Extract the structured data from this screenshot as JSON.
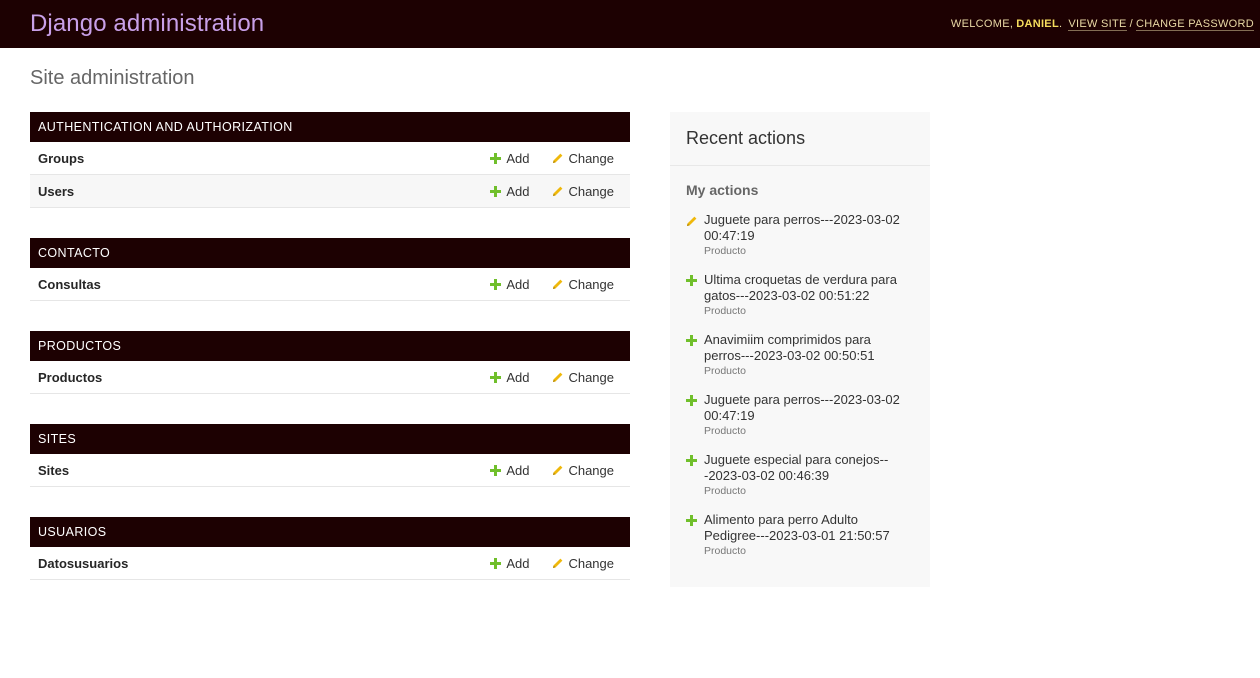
{
  "header": {
    "branding": "Django administration",
    "welcome": "WELCOME,",
    "username": "DANIEL",
    "username_suffix": ".",
    "view_site": "VIEW SITE",
    "separator": "/",
    "change_password": "CHANGE PASSWORD"
  },
  "page_title": "Site administration",
  "modules": [
    {
      "caption": "AUTHENTICATION AND AUTHORIZATION",
      "models": [
        {
          "name": "Groups"
        },
        {
          "name": "Users"
        }
      ]
    },
    {
      "caption": "CONTACTO",
      "models": [
        {
          "name": "Consultas"
        }
      ]
    },
    {
      "caption": "PRODUCTOS",
      "models": [
        {
          "name": "Productos"
        }
      ]
    },
    {
      "caption": "SITES",
      "models": [
        {
          "name": "Sites"
        }
      ]
    },
    {
      "caption": "USUARIOS",
      "models": [
        {
          "name": "Datosusuarios"
        }
      ]
    }
  ],
  "labels": {
    "add": "Add",
    "change": "Change"
  },
  "recent": {
    "title": "Recent actions",
    "subtitle": "My actions",
    "items": [
      {
        "icon": "pencil-icon",
        "text_line1": "Juguete para perros---2023-03-02",
        "text_line2": "00:47:19",
        "type": "Producto"
      },
      {
        "icon": "plus-icon",
        "text_line1": "Ultima croquetas de verdura para",
        "text_line2": "gatos---2023-03-02 00:51:22",
        "type": "Producto"
      },
      {
        "icon": "plus-icon",
        "text_line1": "Anavimiim comprimidos para",
        "text_line2": "perros---2023-03-02 00:50:51",
        "type": "Producto"
      },
      {
        "icon": "plus-icon",
        "text_line1": "Juguete para perros---2023-03-02",
        "text_line2": "00:47:19",
        "type": "Producto"
      },
      {
        "icon": "plus-icon",
        "text_line1": "Juguete especial para conejos--",
        "text_line2": "-2023-03-02 00:46:39",
        "type": "Producto"
      },
      {
        "icon": "plus-icon",
        "text_line1": "Alimento para perro Adulto",
        "text_line2": "Pedigree---2023-03-01 21:50:57",
        "type": "Producto"
      }
    ]
  },
  "colors": {
    "header_bg": "#1d0102",
    "branding": "#c8a0e8",
    "add_icon": "#70bf2b",
    "change_icon": "#efb80b"
  }
}
